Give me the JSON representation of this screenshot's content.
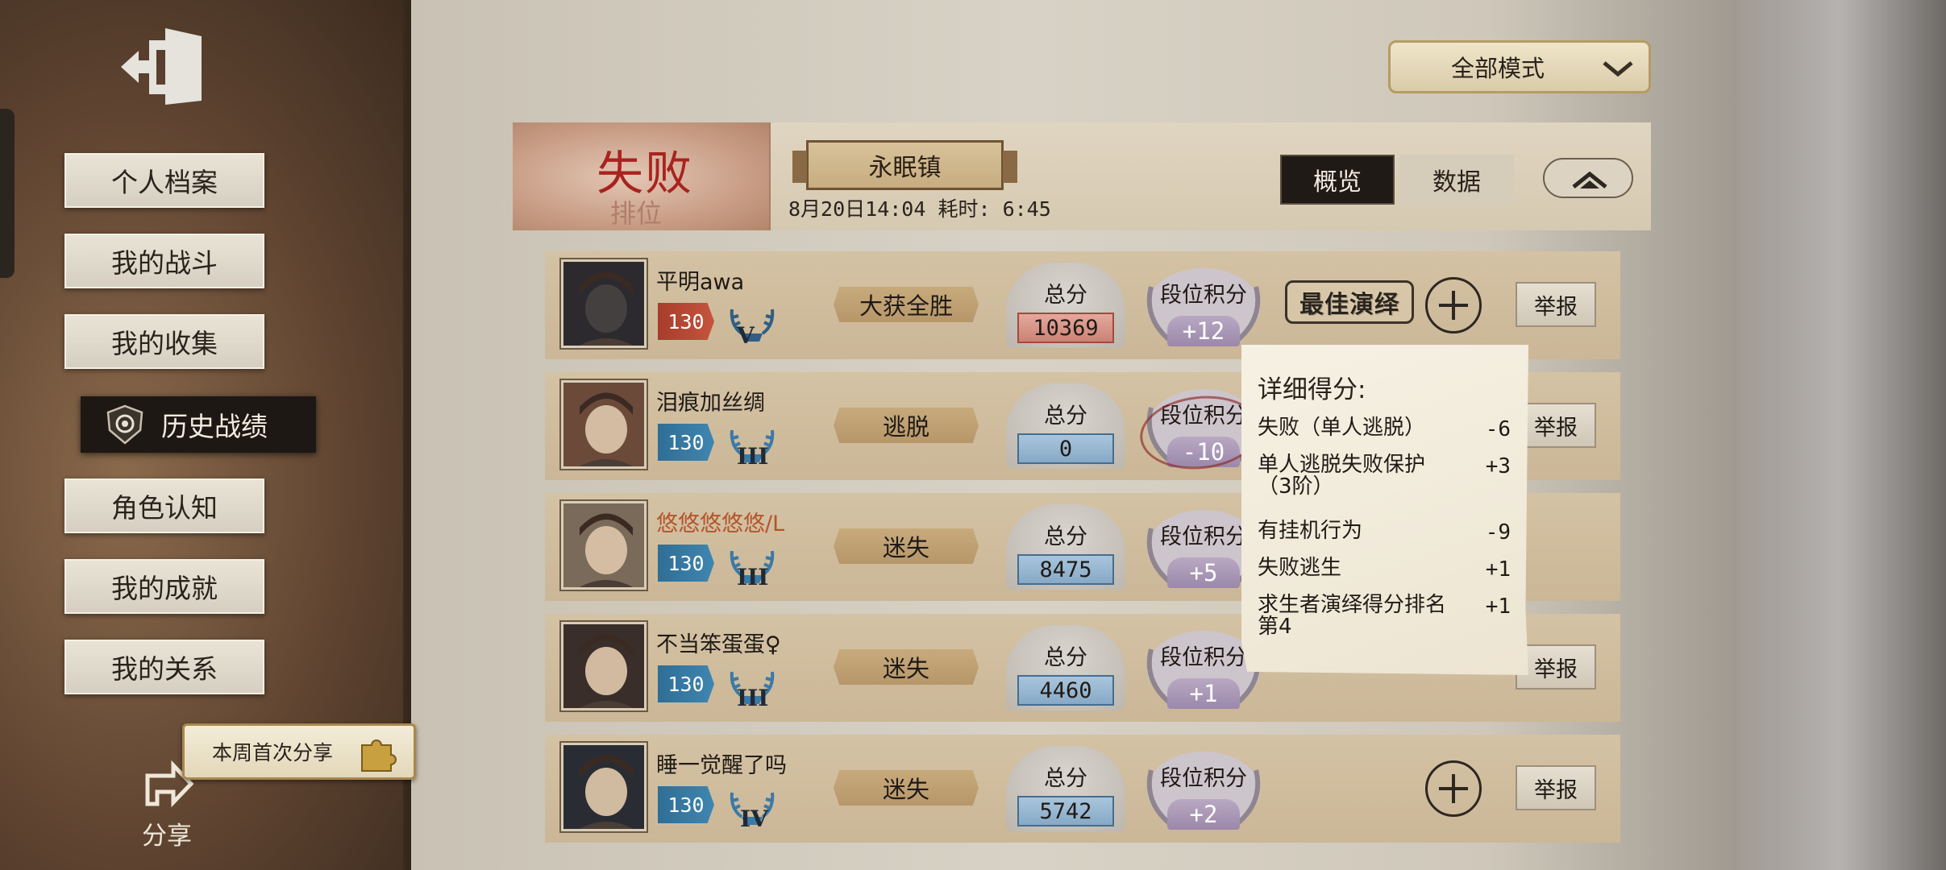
{
  "sidebar": {
    "items": [
      {
        "label": "个人档案"
      },
      {
        "label": "我的战斗"
      },
      {
        "label": "我的收集"
      },
      {
        "label": "历史战绩"
      },
      {
        "label": "角色认知"
      },
      {
        "label": "我的成就"
      },
      {
        "label": "我的关系"
      }
    ],
    "active_index": 3,
    "share_bubble": "本周首次分享",
    "share_label": "分享"
  },
  "mode_dropdown": {
    "selected": "全部模式"
  },
  "match": {
    "result": "失败",
    "result_sub": "排位",
    "map": "永眠镇",
    "time": "8月20日14:04 耗时: 6:45",
    "tabs": {
      "overview": "概览",
      "data": "数据"
    }
  },
  "players": [
    {
      "name": "平明awa",
      "level": "130",
      "level_color": "#b94a35",
      "rank_tier": "V",
      "outcome": "大获全胜",
      "score_label": "总分",
      "score": "10369",
      "rank_label": "段位积分",
      "rank_delta": "+12",
      "mvp": "最佳演绎",
      "report": "举报"
    },
    {
      "name": "泪痕加丝绸",
      "level": "130",
      "level_color": "#3779a3",
      "rank_tier": "III",
      "outcome": "逃脱",
      "score_label": "总分",
      "score": "0",
      "rank_label": "段位积分",
      "rank_delta": "-10",
      "report": "举报"
    },
    {
      "name": "悠悠悠悠悠/L",
      "level": "130",
      "level_color": "#3779a3",
      "rank_tier": "III",
      "outcome": "迷失",
      "score_label": "总分",
      "score": "8475",
      "rank_label": "段位积分",
      "rank_delta": "+5"
    },
    {
      "name": "不当笨蛋蛋♀",
      "level": "130",
      "level_color": "#3779a3",
      "rank_tier": "III",
      "outcome": "迷失",
      "score_label": "总分",
      "score": "4460",
      "rank_label": "段位积分",
      "rank_delta": "+1",
      "report": "举报"
    },
    {
      "name": "睡一觉醒了吗",
      "level": "130",
      "level_color": "#3779a3",
      "rank_tier": "IV",
      "outcome": "迷失",
      "score_label": "总分",
      "score": "5742",
      "rank_label": "段位积分",
      "rank_delta": "+2",
      "report": "举报"
    }
  ],
  "detail_popup": {
    "title": "详细得分:",
    "items": [
      {
        "label": "失败（单人逃脱）",
        "value": "-6"
      },
      {
        "label": "单人逃脱失败保护（3阶）",
        "value": "+3"
      },
      {
        "label": "有挂机行为",
        "value": "-9"
      },
      {
        "label": "失败逃生",
        "value": "+1"
      },
      {
        "label": "求生者演绎得分排名第4",
        "value": "+1"
      }
    ]
  }
}
